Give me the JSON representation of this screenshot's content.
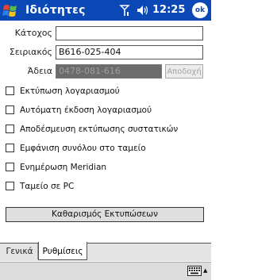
{
  "titlebar": {
    "title": "Ιδιότητες",
    "time": "12:25",
    "ok_label": "ok"
  },
  "form": {
    "owner": {
      "label": "Κάτοχος",
      "value": ""
    },
    "serial": {
      "label": "Σειριακός",
      "value": "B616-025-404"
    },
    "license": {
      "label": "Άδεια",
      "value": "0478-081-616",
      "button": "Αποδοχή"
    }
  },
  "options": [
    {
      "label": "Εκτύπωση λογαριασμού",
      "checked": false
    },
    {
      "label": "Αυτόματη έκδοση λογαριασμού",
      "checked": false
    },
    {
      "label": "Αποδέσμευση εκτύπωσης συστατικών",
      "checked": false
    },
    {
      "label": "Εμφάνιση συνόλου στο ταμείο",
      "checked": false
    },
    {
      "label": "Ενημέρωση Meridian",
      "checked": false
    },
    {
      "label": "Ταμείο σε PC",
      "checked": false
    }
  ],
  "clear_button": "Καθαρισμός Εκτυπώσεων",
  "tabs": [
    {
      "label": "Γενικά",
      "active": false
    },
    {
      "label": "Ρυθμίσεις",
      "active": true
    }
  ],
  "colors": {
    "titlebar": "#0a49b5",
    "tabstrip": "#e4e4e4",
    "disabled_field": "#6c6c6c"
  },
  "icons": [
    "windows-start-icon",
    "signal-icon",
    "volume-icon",
    "keyboard-icon"
  ]
}
